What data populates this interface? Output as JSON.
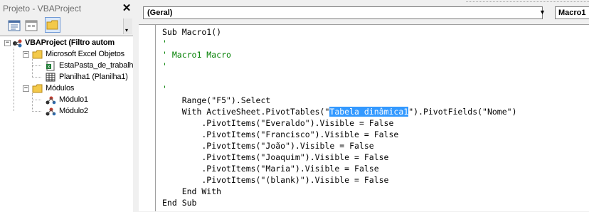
{
  "project_pane": {
    "title": "Projeto - VBAProject",
    "close_glyph": "✕",
    "toolbar": {
      "buttons": [
        "view-code",
        "view-object",
        "toggle-folders"
      ]
    },
    "tree": {
      "root": "VBAProject (Filtro autom",
      "excel_objects_folder": "Microsoft Excel Objetos",
      "workbook": "EstaPasta_de_trabalho",
      "sheet": "Planilha1 (Planilha1)",
      "modules_folder": "Módulos",
      "module1": "Módulo1",
      "module2": "Módulo2",
      "minus": "−"
    }
  },
  "code_window": {
    "object_combo": "(Geral)",
    "procedure_combo": "Macro1",
    "dropdown_glyph": "▼",
    "lines": {
      "l1": "Sub Macro1()",
      "l2": "'",
      "l3": "' Macro1 Macro",
      "l4": "'",
      "l5": "",
      "l6": "'",
      "l7": "    Range(\"F5\").Select",
      "l8_pre": "    With ActiveSheet.PivotTables(\"",
      "l8_sel": "Tabela dinâmica1",
      "l8_post": "\").PivotFields(\"Nome\")",
      "l9": "        .PivotItems(\"Everaldo\").Visible = False",
      "l10": "        .PivotItems(\"Francisco\").Visible = False",
      "l11": "        .PivotItems(\"João\").Visible = False",
      "l12": "        .PivotItems(\"Joaquim\").Visible = False",
      "l13": "        .PivotItems(\"Maria\").Visible = False",
      "l14": "        .PivotItems(\"(blank)\").Visible = False",
      "l15": "    End With",
      "l16": "End Sub"
    },
    "colors": {
      "comment": "#007f00",
      "selection": "#3399ff",
      "text": "#000000"
    }
  }
}
